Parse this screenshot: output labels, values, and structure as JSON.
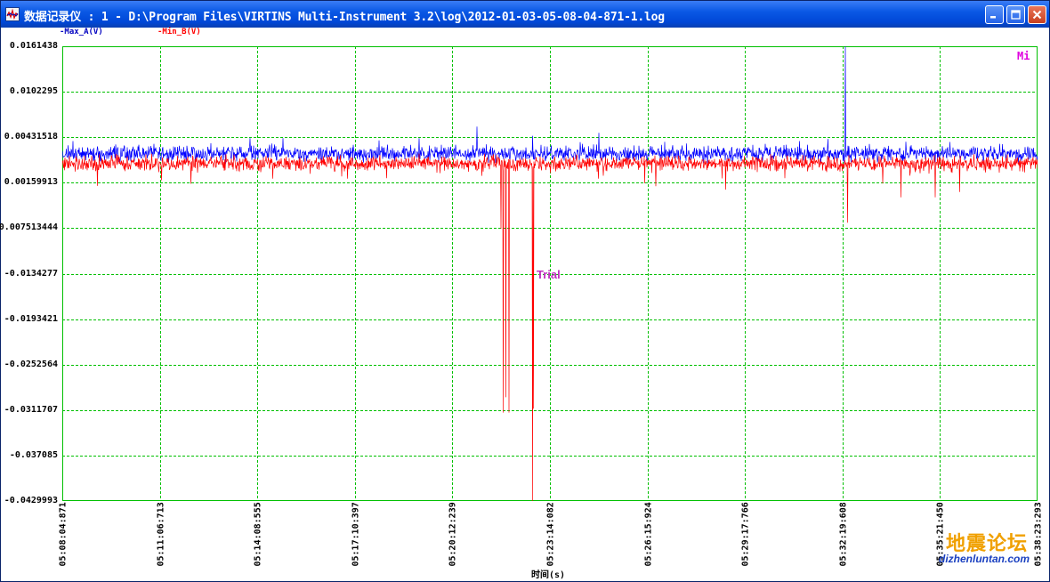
{
  "window": {
    "title": "数据记录仪 : 1 - D:\\Program Files\\VIRTINS Multi-Instrument 3.2\\log\\2012-01-03-05-08-04-871-1.log",
    "minimize_icon": "minimize-icon",
    "maximize_icon": "maximize-icon",
    "close_icon": "close-icon",
    "titlebar_color": "#0a58e5"
  },
  "legend": {
    "series_a": "-Max_A(V)",
    "series_b": "-Min_B(V)"
  },
  "overlay": {
    "trial": "Trial",
    "mi": "Mi"
  },
  "watermark": {
    "text_cn": "地震论坛",
    "url": "dizhenluntan.com"
  },
  "chart_data": {
    "type": "line",
    "xlabel": "时间(s)",
    "ylabel": "",
    "ylim": [
      -0.0429993,
      0.0161438
    ],
    "y_ticks": [
      "0.0161438",
      "0.0102295",
      "0.00431518",
      "0.00159913",
      "0.007513444",
      "-0.0134277",
      "-0.0193421",
      "-0.0252564",
      "-0.0311707",
      "-0.037085",
      "-0.0429993"
    ],
    "x_ticks": [
      "05:08:04:871",
      "05:11:06:713",
      "05:14:08:555",
      "05:17:10:397",
      "05:20:12:239",
      "05:23:14:082",
      "05:26:15:924",
      "05:29:17:766",
      "05:32:19:608",
      "05:35:21:450",
      "05:38:23:293"
    ],
    "grid": true,
    "series": [
      {
        "name": "Max_A(V)",
        "color": "#0000ff",
        "baseline": 0.0022,
        "noise": 0.0006,
        "spikes": [
          {
            "x": 0.425,
            "y": 0.0057
          },
          {
            "x": 0.482,
            "y": 0.0045
          },
          {
            "x": 0.803,
            "y": 0.0161
          },
          {
            "x": 0.785,
            "y": 0.0041
          },
          {
            "x": 0.12,
            "y": 0.0032
          },
          {
            "x": 0.325,
            "y": 0.0039
          },
          {
            "x": 0.64,
            "y": 0.0035
          },
          {
            "x": 0.91,
            "y": 0.0037
          },
          {
            "x": 0.99,
            "y": 0.0031
          }
        ]
      },
      {
        "name": "Min_B(V)",
        "color": "#ff0000",
        "baseline": 0.0009,
        "noise": 0.0006,
        "spikes": [
          {
            "x": 0.45,
            "y": -0.0076
          },
          {
            "x": 0.452,
            "y": -0.0315
          },
          {
            "x": 0.455,
            "y": -0.0295
          },
          {
            "x": 0.458,
            "y": -0.0315
          },
          {
            "x": 0.482,
            "y": -0.0429993
          },
          {
            "x": 0.483,
            "y": -0.031
          },
          {
            "x": 0.805,
            "y": -0.0068
          },
          {
            "x": 0.86,
            "y": -0.0035
          },
          {
            "x": 0.895,
            "y": -0.0035
          },
          {
            "x": 0.68,
            "y": -0.0025
          },
          {
            "x": 0.92,
            "y": -0.0028
          }
        ]
      }
    ],
    "axis_color": "#00c000",
    "grid_color": "#00c000"
  }
}
